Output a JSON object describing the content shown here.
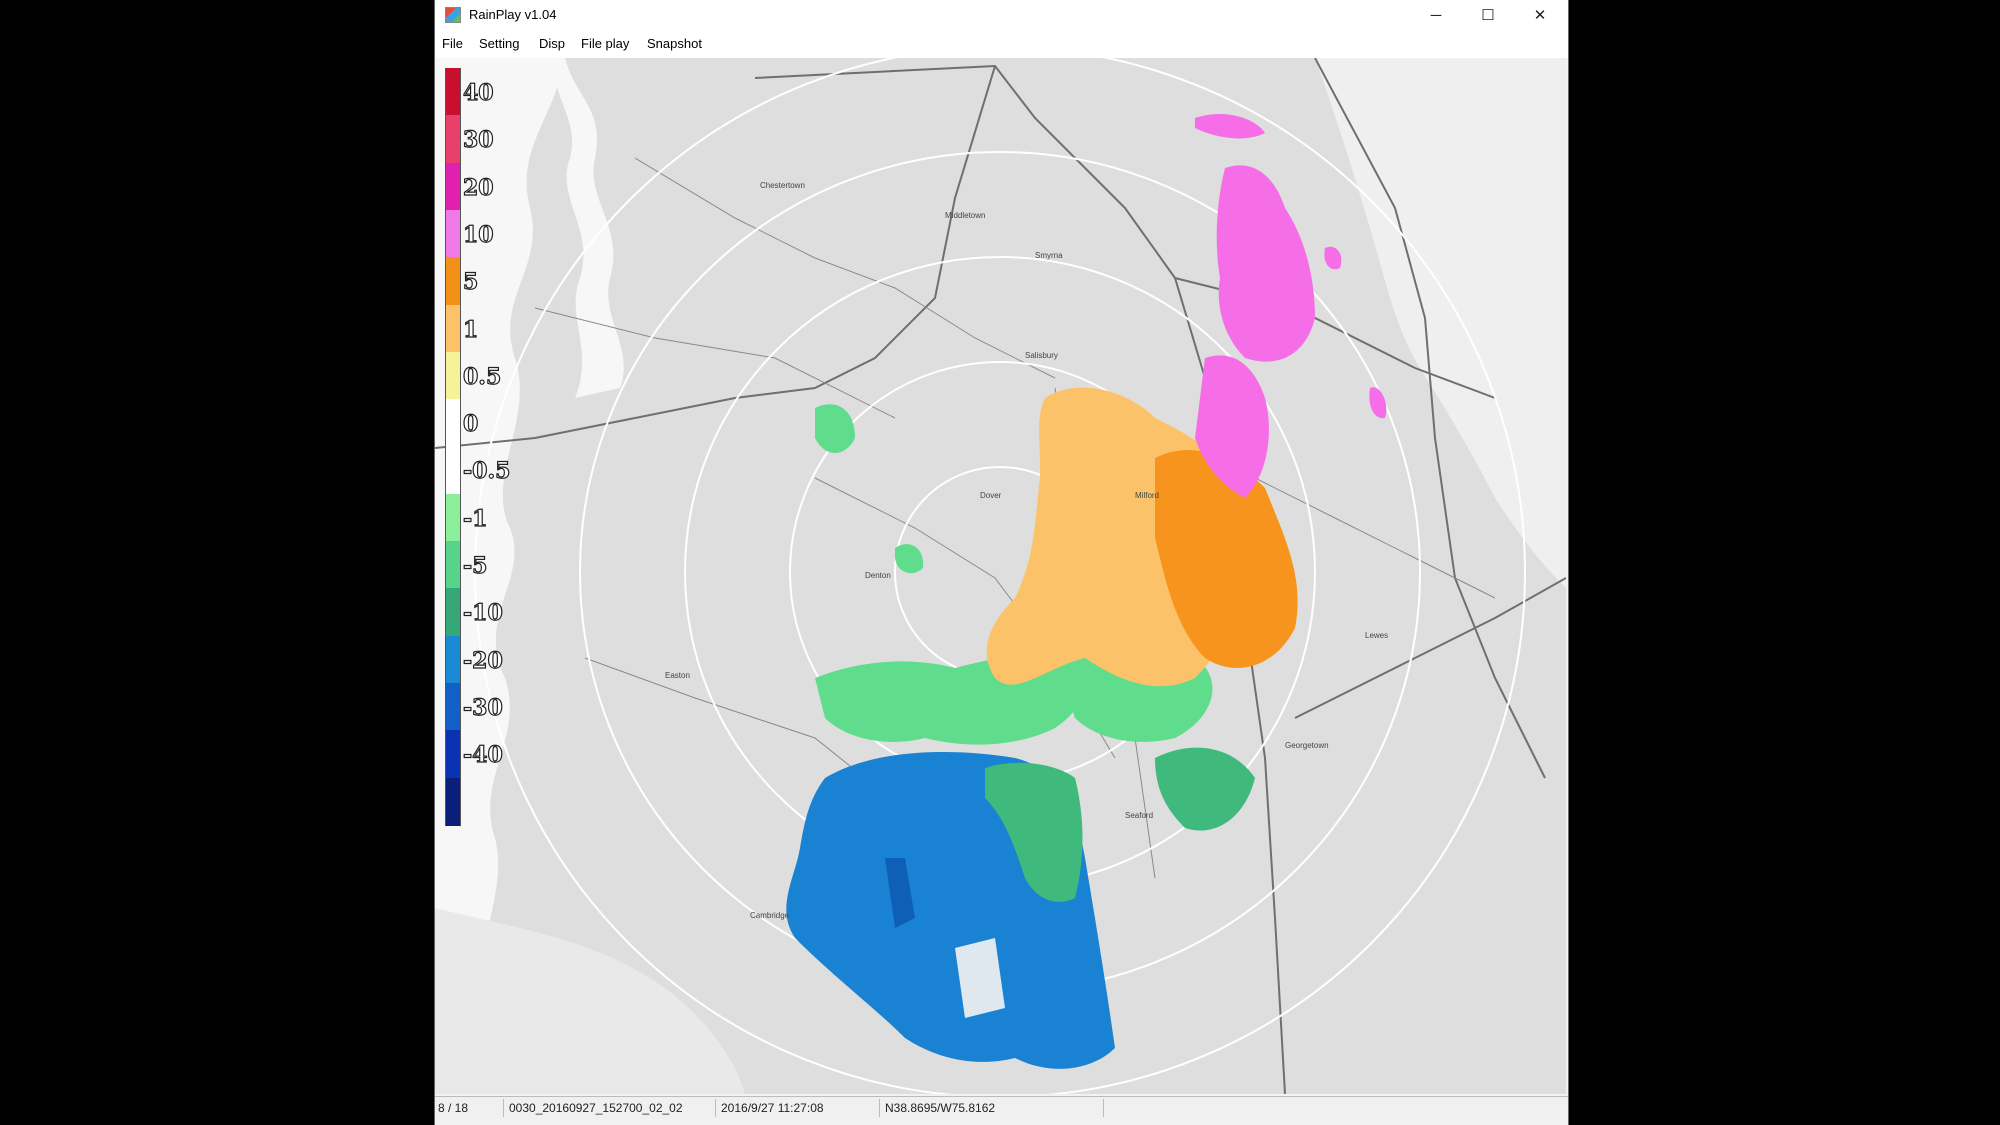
{
  "window": {
    "title": "RainPlay v1.04",
    "icon": "app-icon"
  },
  "controls": {
    "minimize": "─",
    "maximize": "☐",
    "close": "✕"
  },
  "menu": [
    "File",
    "Setting",
    "Disp",
    "File play",
    "Snapshot"
  ],
  "legend": [
    {
      "label": "40",
      "color": "#c8102e"
    },
    {
      "label": "30",
      "color": "#e8406a"
    },
    {
      "label": "20",
      "color": "#e020b0"
    },
    {
      "label": "10",
      "color": "#f07ae8"
    },
    {
      "label": "5",
      "color": "#f39018"
    },
    {
      "label": "1",
      "color": "#fbc269"
    },
    {
      "label": "0.5",
      "color": "#f6f29a"
    },
    {
      "label": "0",
      "color": "#ffffff"
    },
    {
      "label": "-0.5",
      "color": "#ffffff"
    },
    {
      "label": "-1",
      "color": "#8cef9c"
    },
    {
      "label": "-5",
      "color": "#58d48a"
    },
    {
      "label": "-10",
      "color": "#36a878"
    },
    {
      "label": "-20",
      "color": "#1a8ad6"
    },
    {
      "label": "-30",
      "color": "#1060c8"
    },
    {
      "label": "-40",
      "color": "#0a32b4"
    },
    {
      "label": "",
      "color": "#0a1f7a"
    }
  ],
  "map": {
    "towns": [
      "Chestertown",
      "Dover",
      "Milford",
      "Salisbury",
      "Cambridge",
      "Easton",
      "Denton",
      "Seaford",
      "Georgetown",
      "Lewes",
      "Smyrna",
      "Middletown"
    ]
  },
  "status": {
    "frame": "8 / 18",
    "file": "0030_20160927_152700_02_02",
    "datetime": "2016/9/27 11:27:08",
    "coords": "N38.8695/W75.8162"
  },
  "colors": {
    "pink": "#f56ee8",
    "orange": "#f7941d",
    "lightorange": "#fbc269",
    "green": "#5fdc8c",
    "blue": "#1a82d2",
    "map": "#dedede",
    "water": "#f7f7f7"
  }
}
